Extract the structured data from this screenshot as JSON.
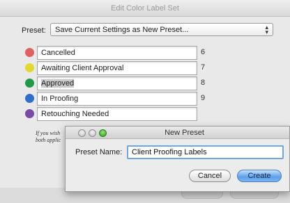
{
  "window": {
    "title": "Edit Color Label Set"
  },
  "preset": {
    "label": "Preset:",
    "value": "Save Current Settings as New Preset...",
    "arrows": "⌃⌄"
  },
  "labels": [
    {
      "color": "#e06060",
      "name": "Cancelled",
      "number": "6"
    },
    {
      "color": "#e4d92a",
      "name": "Awaiting Client Approval",
      "number": "7"
    },
    {
      "color": "#1f9b44",
      "name": "Approved",
      "number": "8"
    },
    {
      "color": "#2f6fcb",
      "name": "In Proofing",
      "number": "9"
    },
    {
      "color": "#7b4aa8",
      "name": "Retouching Needed",
      "number": ""
    }
  ],
  "note": {
    "line1": "If you wish",
    "line2": "both applic"
  },
  "dialog": {
    "title": "New Preset",
    "preset_name_label": "Preset Name:",
    "preset_name_value": "Client Proofing Labels",
    "cancel_label": "Cancel",
    "create_label": "Create"
  }
}
